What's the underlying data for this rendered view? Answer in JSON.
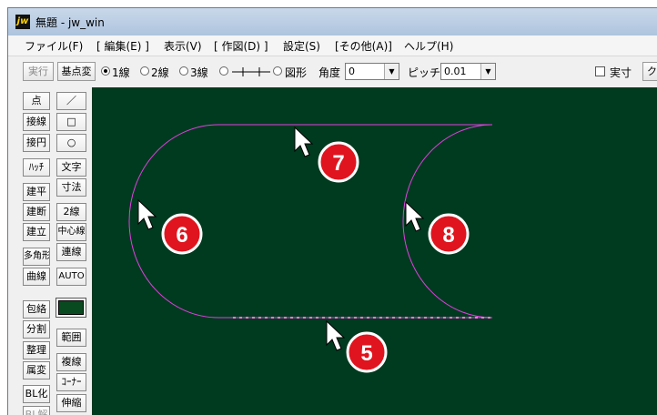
{
  "window": {
    "title": "無題 - jw_win",
    "app_icon_text": "jw"
  },
  "menu": [
    "ファイル(F)",
    "[ 編集(E) ]",
    "表示(V)",
    "[ 作図(D) ]",
    "設定(S)",
    "[その他(A)]",
    "ヘルプ(H)"
  ],
  "toolbar": {
    "execute": "実行",
    "base_change": "基点変",
    "radio_1": "1線",
    "radio_2": "2線",
    "radio_3": "3線",
    "radio_figure": "図形",
    "angle_label": "角度",
    "angle_value": "0",
    "pitch_label": "ピッチ",
    "pitch_value": "0.01",
    "actual_size": "実寸",
    "cut_button": "ク"
  },
  "left_col": [
    "点",
    "接線",
    "接円",
    "ﾊｯﾁ",
    "建平",
    "建断",
    "建立",
    "多角形",
    "曲線",
    "包絡",
    "分割",
    "整理",
    "属変",
    "BL化",
    "BL解"
  ],
  "right_col": [
    "／",
    "□",
    "○",
    "文字",
    "寸法",
    "2線",
    "中心線",
    "連線",
    "AUTO",
    "範囲",
    "複線",
    "ｺｰﾅｰ",
    "伸縮"
  ],
  "annotations": [
    {
      "number": "7"
    },
    {
      "number": "6"
    },
    {
      "number": "8"
    },
    {
      "number": "5"
    }
  ],
  "colors": {
    "canvas": "#003a1f",
    "line": "#e040e0",
    "marker": "#e0141e"
  }
}
